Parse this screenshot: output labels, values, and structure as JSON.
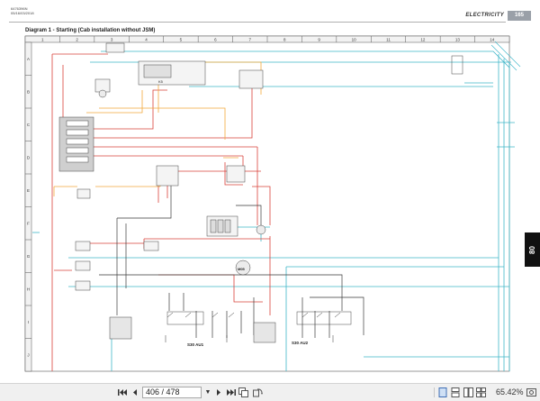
{
  "document": {
    "header_left": [
      "6476396N",
      "05/16/03/2018"
    ],
    "section_title": "ELECTRICITY",
    "page_number": "165",
    "diagram_title": "Diagram 1 - Starting (Cab installation without JSM)",
    "side_tab": "80",
    "columns": [
      "1",
      "2",
      "3",
      "4",
      "5",
      "6",
      "7",
      "8",
      "9",
      "10",
      "11",
      "12",
      "13",
      "14"
    ],
    "rows": [
      "A",
      "B",
      "C",
      "D",
      "E",
      "F",
      "G",
      "H",
      "I",
      "J"
    ],
    "labels": {
      "s30_au1": "S30 AU1",
      "s30_au2": "S30 AU2",
      "m05": "M05",
      "k5": "K5"
    }
  },
  "toolbar": {
    "current_page": "406",
    "total_pages": "478",
    "page_text": "406 / 478",
    "zoom": "65.42%"
  },
  "colors": {
    "red_wire": "#d9413a",
    "orange_wire": "#f2a93b",
    "cyan_wire": "#3fb6c8",
    "black_wire": "#3a3a3a"
  }
}
